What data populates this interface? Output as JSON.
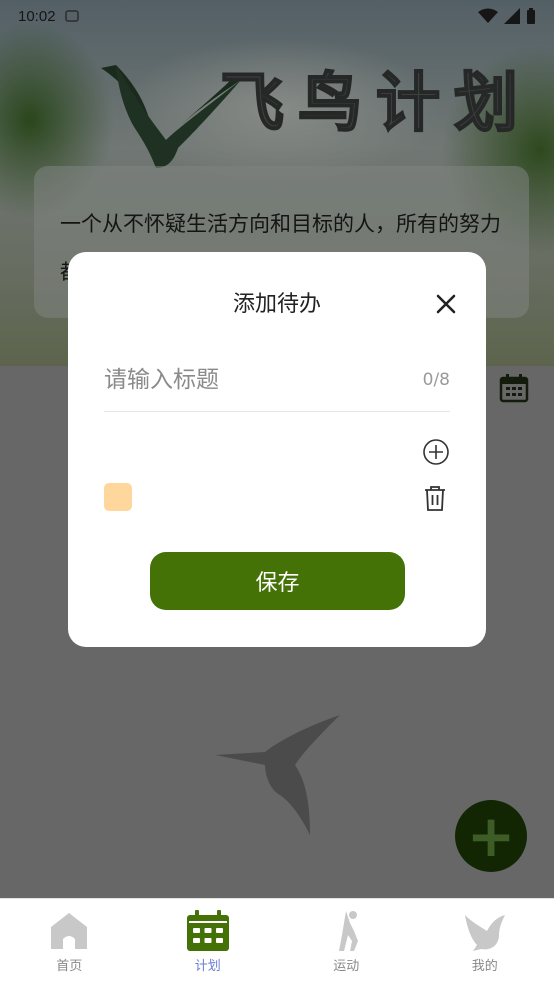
{
  "status_bar": {
    "time": "10:02"
  },
  "background": {
    "hero_title": "飞鸟计划",
    "quote_text": "一个从不怀疑生活方向和目标的人，所有的努力都是有方向的"
  },
  "dialog": {
    "title": "添加待办",
    "title_input": {
      "value": "",
      "placeholder": "请输入标题"
    },
    "char_count": "0/8",
    "swatch_color": "#ffd79c",
    "save_label": "保存"
  },
  "nav": {
    "items": [
      {
        "label": "首页",
        "icon": "home-icon",
        "active": false
      },
      {
        "label": "计划",
        "icon": "calendar-icon",
        "active": true
      },
      {
        "label": "运动",
        "icon": "exercise-icon",
        "active": false
      },
      {
        "label": "我的",
        "icon": "dove-icon",
        "active": false
      }
    ]
  },
  "colors": {
    "accent_green": "#457207",
    "fab_dark": "#1c3a07",
    "nav_active": "#6b7fd6"
  }
}
